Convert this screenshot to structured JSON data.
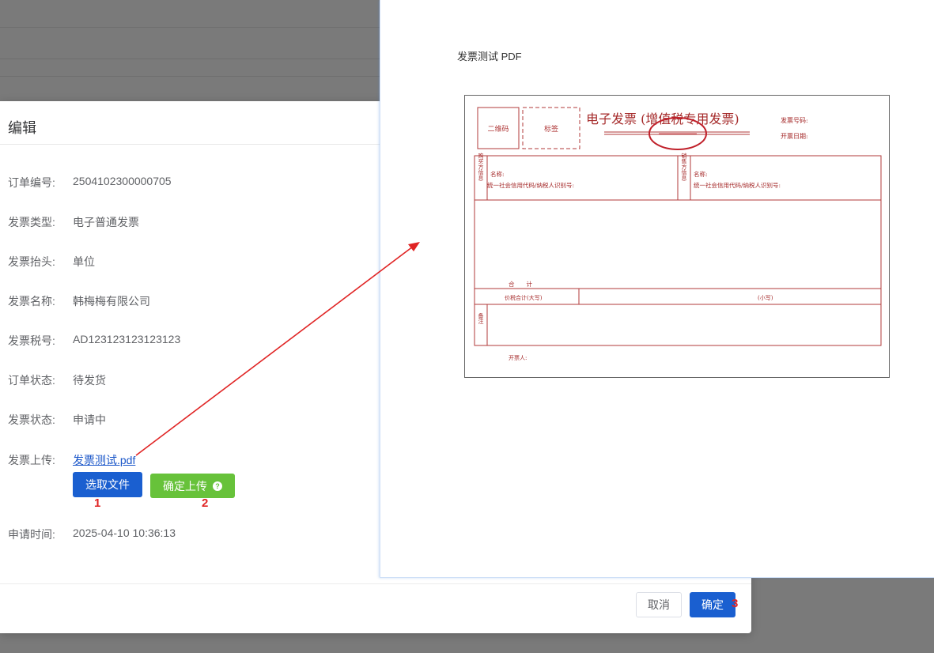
{
  "dialog": {
    "title": "编辑",
    "rows": [
      {
        "label": "订单编号:",
        "value": "2504102300000705"
      },
      {
        "label": "发票类型:",
        "value": "电子普通发票"
      },
      {
        "label": "发票抬头:",
        "value": "单位"
      },
      {
        "label": "发票名称:",
        "value": "韩梅梅有限公司"
      },
      {
        "label": "发票税号:",
        "value": "AD123123123123123"
      },
      {
        "label": "订单状态:",
        "value": "待发货"
      },
      {
        "label": "发票状态:",
        "value": "申请中"
      }
    ],
    "upload": {
      "label": "发票上传:",
      "file_name": "发票测试.pdf",
      "choose_button": "选取文件",
      "upload_button": "确定上传",
      "help_icon": "question-circle-icon"
    },
    "apply_time": {
      "label": "申请时间:",
      "value": "2025-04-10 10:36:13"
    },
    "footer": {
      "cancel": "取消",
      "ok": "确定"
    },
    "steps": [
      "1",
      "2",
      "3"
    ]
  },
  "preview": {
    "title": "发票测试 PDF",
    "invoice": {
      "qr_label": "二维码",
      "tag_label": "标签",
      "heading": "电子发票 (增值税专用发票)",
      "invoice_no_label": "发票号码:",
      "date_label": "开票日期:",
      "buyer_side": "购买方信息",
      "seller_side": "销售方信息",
      "name_label": "名称:",
      "credit_code_label": "统一社会信用代码/纳税人识别号:",
      "total_label": "合　　计",
      "total_upper_label": "价税合计(大写)",
      "total_lower_label": "(小写)",
      "remarks_label": "备注",
      "issuer_label": "开票人:",
      "seal_color": "#c0202a",
      "line_color": "#b03a3a"
    }
  },
  "colors": {
    "primary": "#1a5fd0",
    "success": "#67c23a",
    "annotation": "#e02424",
    "link": "#1a56c9"
  }
}
